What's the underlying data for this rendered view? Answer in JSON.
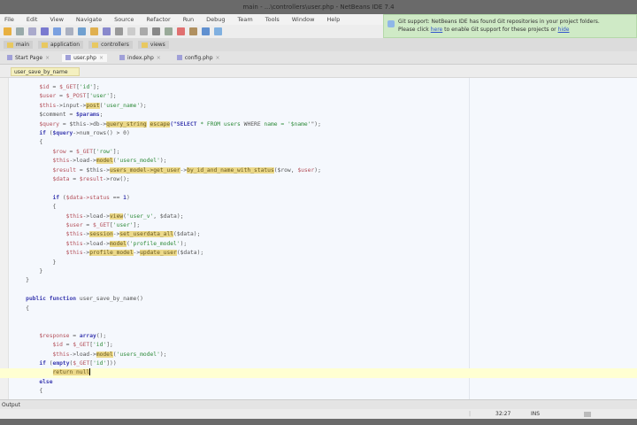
{
  "window": {
    "title": "main - ...\\controllers\\user.php - NetBeans IDE 7.4"
  },
  "menu": [
    "File",
    "Edit",
    "View",
    "Navigate",
    "Source",
    "Refactor",
    "Run",
    "Debug",
    "Team",
    "Tools",
    "Window",
    "Help"
  ],
  "notification": {
    "line1": "Git support: NetBeans IDE has found Git repositories in your project folders.",
    "line2_prefix": "Please click",
    "link1": "here",
    "line2_suffix": "to enable Git support for these projects or",
    "link2": "hide"
  },
  "projects": [
    "main",
    "application",
    "controllers",
    "views"
  ],
  "editor_tabs": [
    "Start Page",
    "user.php",
    "index.php",
    "config.php"
  ],
  "nav": {
    "path": "user_save_by_name"
  },
  "code": [
    {
      "indent": 2,
      "t": [
        [
          "v",
          "$id"
        ],
        [
          "o",
          " = "
        ],
        [
          "v",
          "$_GET"
        ],
        [
          "o",
          "["
        ],
        [
          "s",
          "'id'"
        ],
        [
          "o",
          "];"
        ]
      ]
    },
    {
      "indent": 2,
      "t": [
        [
          "v",
          "$user"
        ],
        [
          "o",
          " = "
        ],
        [
          "v",
          "$_POST"
        ],
        [
          "o",
          "["
        ],
        [
          "s",
          "'user'"
        ],
        [
          "o",
          "];"
        ]
      ]
    },
    {
      "indent": 2,
      "t": [
        [
          "v",
          "$this"
        ],
        [
          "o",
          "->input->"
        ],
        [
          "f",
          "post"
        ],
        [
          "o",
          "("
        ],
        [
          "s",
          "'user_name'"
        ],
        [
          "o",
          ");"
        ]
      ]
    },
    {
      "indent": 2,
      "t": [
        [
          "o",
          "$comment = "
        ],
        [
          "k",
          "$params"
        ],
        [
          "o",
          ";"
        ]
      ]
    },
    {
      "indent": 2,
      "t": [
        [
          "v",
          "$query"
        ],
        [
          "o",
          " = $this->db->"
        ],
        [
          "f",
          "query_string"
        ],
        [
          "o",
          " "
        ],
        [
          "f",
          "escape"
        ],
        [
          "k",
          "(\"SELECT"
        ],
        [
          "s",
          " * FROM users"
        ],
        [
          "o",
          " WHERE "
        ],
        [
          "s",
          "name = '$name'"
        ],
        [
          "o",
          "\");"
        ]
      ]
    },
    {
      "indent": 2,
      "t": [
        [
          "k",
          "if"
        ],
        [
          "o",
          " ("
        ],
        [
          "k",
          "$query"
        ],
        [
          "o",
          "->num_rows() > 0)"
        ]
      ]
    },
    {
      "indent": 2,
      "t": [
        [
          "o",
          "{"
        ]
      ]
    },
    {
      "indent": 3,
      "t": [
        [
          "v",
          "$row"
        ],
        [
          "o",
          " = "
        ],
        [
          "v",
          "$_GET"
        ],
        [
          "o",
          "["
        ],
        [
          "s",
          "'row'"
        ],
        [
          "o",
          "];"
        ]
      ]
    },
    {
      "indent": 3,
      "t": [
        [
          "v",
          "$this"
        ],
        [
          "o",
          "->load->"
        ],
        [
          "f",
          "model"
        ],
        [
          "o",
          "("
        ],
        [
          "s",
          "'users_model'"
        ],
        [
          "o",
          ");"
        ]
      ]
    },
    {
      "indent": 3,
      "t": [
        [
          "v",
          "$result"
        ],
        [
          "o",
          " = $this->"
        ],
        [
          "f",
          "users_model->get_user"
        ],
        [
          "o",
          "->"
        ],
        [
          "f",
          "by_id_and_name_with_status"
        ],
        [
          "o",
          "($row, "
        ],
        [
          "v",
          "$user"
        ],
        [
          "o",
          ");"
        ]
      ]
    },
    {
      "indent": 3,
      "t": [
        [
          "v",
          "$data"
        ],
        [
          "o",
          " = "
        ],
        [
          "v",
          "$result"
        ],
        [
          "o",
          "->row();"
        ]
      ]
    },
    {
      "indent": 3,
      "t": []
    },
    {
      "indent": 3,
      "t": [
        [
          "k",
          "if"
        ],
        [
          "o",
          " ("
        ],
        [
          "v",
          "$data->status"
        ],
        [
          "o",
          " == "
        ],
        [
          "k",
          "1"
        ],
        [
          "o",
          ")"
        ]
      ]
    },
    {
      "indent": 3,
      "t": [
        [
          "o",
          "{"
        ]
      ]
    },
    {
      "indent": 4,
      "t": [
        [
          "v",
          "$this"
        ],
        [
          "o",
          "->load->"
        ],
        [
          "f",
          "view"
        ],
        [
          "o",
          "("
        ],
        [
          "s",
          "'user_v'"
        ],
        [
          "o",
          ", $data);"
        ]
      ]
    },
    {
      "indent": 4,
      "t": [
        [
          "v",
          "$user"
        ],
        [
          "o",
          " = "
        ],
        [
          "v",
          "$_GET"
        ],
        [
          "o",
          "["
        ],
        [
          "s",
          "'user'"
        ],
        [
          "o",
          "];"
        ]
      ]
    },
    {
      "indent": 4,
      "t": [
        [
          "v",
          "$this"
        ],
        [
          "o",
          "->"
        ],
        [
          "f",
          "session"
        ],
        [
          "o",
          "->"
        ],
        [
          "f",
          "set_userdata_all"
        ],
        [
          "o",
          "($data);"
        ]
      ]
    },
    {
      "indent": 4,
      "t": [
        [
          "v",
          "$this"
        ],
        [
          "o",
          "->load->"
        ],
        [
          "f",
          "model"
        ],
        [
          "o",
          "("
        ],
        [
          "s",
          "'profile_model'"
        ],
        [
          "o",
          ");"
        ]
      ]
    },
    {
      "indent": 4,
      "t": [
        [
          "v",
          "$this"
        ],
        [
          "o",
          "->"
        ],
        [
          "f",
          "profile_model"
        ],
        [
          "o",
          "->"
        ],
        [
          "f",
          "update_user"
        ],
        [
          "o",
          "($data);"
        ]
      ]
    },
    {
      "indent": 3,
      "t": [
        [
          "o",
          "}"
        ]
      ]
    },
    {
      "indent": 2,
      "t": [
        [
          "o",
          "}"
        ]
      ]
    },
    {
      "indent": 1,
      "t": [
        [
          "o",
          "}"
        ]
      ]
    },
    {
      "indent": 1,
      "t": []
    },
    {
      "indent": 1,
      "t": [
        [
          "k",
          "public"
        ],
        [
          "o",
          " "
        ],
        [
          "k",
          "function"
        ],
        [
          "o",
          " user_save_by_name()"
        ]
      ]
    },
    {
      "indent": 1,
      "t": [
        [
          "o",
          "{"
        ]
      ]
    },
    {
      "indent": 1,
      "t": []
    },
    {
      "indent": 1,
      "t": []
    },
    {
      "indent": 2,
      "t": [
        [
          "v",
          "$response"
        ],
        [
          "o",
          " = "
        ],
        [
          "k",
          "array"
        ],
        [
          "o",
          "();"
        ]
      ]
    },
    {
      "indent": 3,
      "t": [
        [
          "v",
          "$id"
        ],
        [
          "o",
          " = "
        ],
        [
          "v",
          "$_GET"
        ],
        [
          "o",
          "["
        ],
        [
          "s",
          "'id'"
        ],
        [
          "o",
          "];"
        ]
      ]
    },
    {
      "indent": 3,
      "t": [
        [
          "v",
          "$this"
        ],
        [
          "o",
          "->load->"
        ],
        [
          "f",
          "model"
        ],
        [
          "o",
          "("
        ],
        [
          "s",
          "'users_model'"
        ],
        [
          "o",
          ");"
        ]
      ]
    },
    {
      "indent": 2,
      "t": [
        [
          "k",
          "if"
        ],
        [
          "o",
          " ("
        ],
        [
          "k",
          "empty"
        ],
        [
          "o",
          "("
        ],
        [
          "v",
          "$_GET"
        ],
        [
          "o",
          "["
        ],
        [
          "s",
          "'id'"
        ],
        [
          "o",
          "]))"
        ]
      ]
    },
    {
      "indent": 3,
      "cur": true,
      "t": [
        [
          "f",
          "return null"
        ]
      ]
    },
    {
      "indent": 2,
      "t": [
        [
          "k",
          "else"
        ]
      ]
    },
    {
      "indent": 2,
      "t": [
        [
          "o",
          "{"
        ]
      ]
    }
  ],
  "output": {
    "label": "Output"
  },
  "status": {
    "position": "32:27",
    "mode": "INS"
  }
}
